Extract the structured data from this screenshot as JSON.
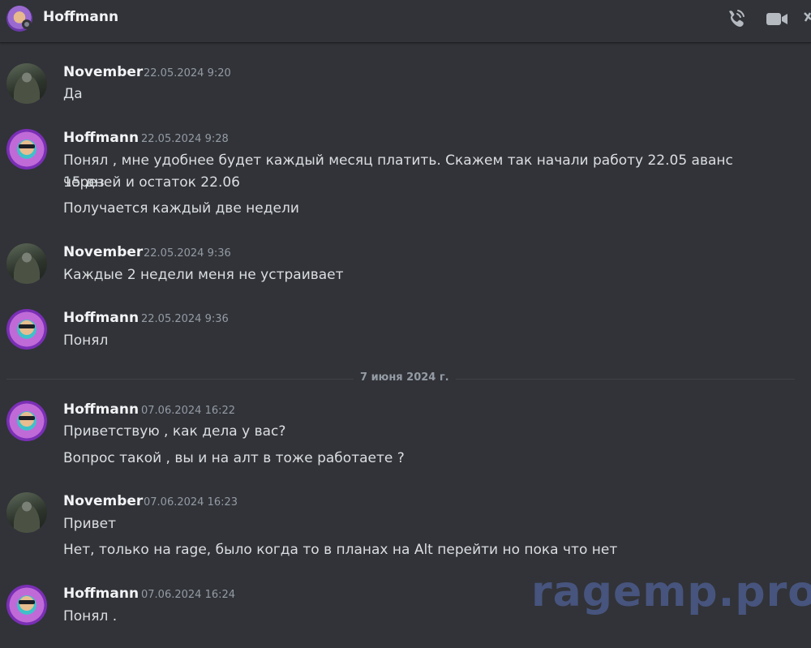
{
  "header": {
    "title": "Hoffmann"
  },
  "divider": {
    "label": "7 июня 2024 г."
  },
  "messages": [
    {
      "author": "November",
      "timestamp": "22.05.2024 9:20",
      "lines": [
        "Да"
      ]
    },
    {
      "author": "Hoffmann",
      "timestamp": "22.05.2024 9:28",
      "lines": [
        "Понял , мне удобнее будет каждый месяц платить. Скажем так начали работу 22.05 аванс через",
        "15 дней и остаток 22.06",
        "Получается каждый две недели"
      ]
    },
    {
      "author": "November",
      "timestamp": "22.05.2024 9:36",
      "lines": [
        "Каждые 2 недели меня не устраивает"
      ]
    },
    {
      "author": "Hoffmann",
      "timestamp": "22.05.2024 9:36",
      "lines": [
        "Понял"
      ]
    },
    {
      "author": "Hoffmann",
      "timestamp": "07.06.2024 16:22",
      "lines": [
        "Приветствую , как дела  у вас?",
        "Вопрос такой , вы и на алт в тоже работаете ?"
      ]
    },
    {
      "author": "November",
      "timestamp": "07.06.2024 16:23",
      "lines": [
        "Привет",
        "Нет, только на rage, было когда то в планах на Alt перейти но пока что нет"
      ]
    },
    {
      "author": "Hoffmann",
      "timestamp": "07.06.2024 16:24",
      "lines": [
        "Понял ."
      ]
    }
  ],
  "watermark": "ragemp.pro",
  "icons": {
    "call": "phone-call-icon",
    "video": "video-camera-icon",
    "pin": "pin-icon"
  }
}
